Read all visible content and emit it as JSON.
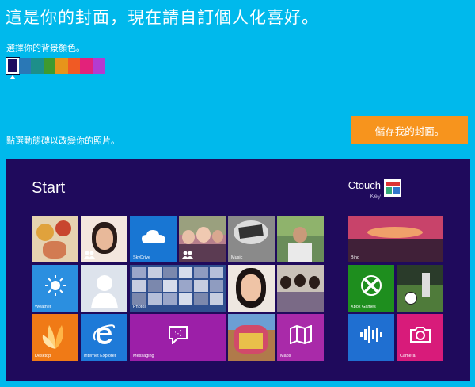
{
  "header": {
    "title": "這是你的封面，現在請自訂個人化喜好。",
    "bg_label": "選擇你的背景顏色。",
    "photo_hint": "點選動態磚以改變你的照片。",
    "save_label": "儲存我的封面。"
  },
  "colors": {
    "page_bg": "#00b9ec",
    "start_bg": "#1f0a5c",
    "save_button": "#f7941d",
    "swatches": [
      "#1b0b5e",
      "#2a78b6",
      "#1d8f8a",
      "#3f9a2f",
      "#e7941b",
      "#f05a24",
      "#e3227a",
      "#b43bd0"
    ]
  },
  "preview": {
    "start_label": "Start",
    "user_name": "Ctouch",
    "user_sub": "Key",
    "tiles": {
      "skydrive": "SkyDrive",
      "music": "Music",
      "bing": "Bing",
      "weather": "Weather",
      "photos": "Photos",
      "xbox": "Xbox Games",
      "desktop": "Desktop",
      "ie": "Internet Explorer",
      "messaging": "Messaging",
      "maps": "Maps",
      "camera": "Camera"
    }
  }
}
